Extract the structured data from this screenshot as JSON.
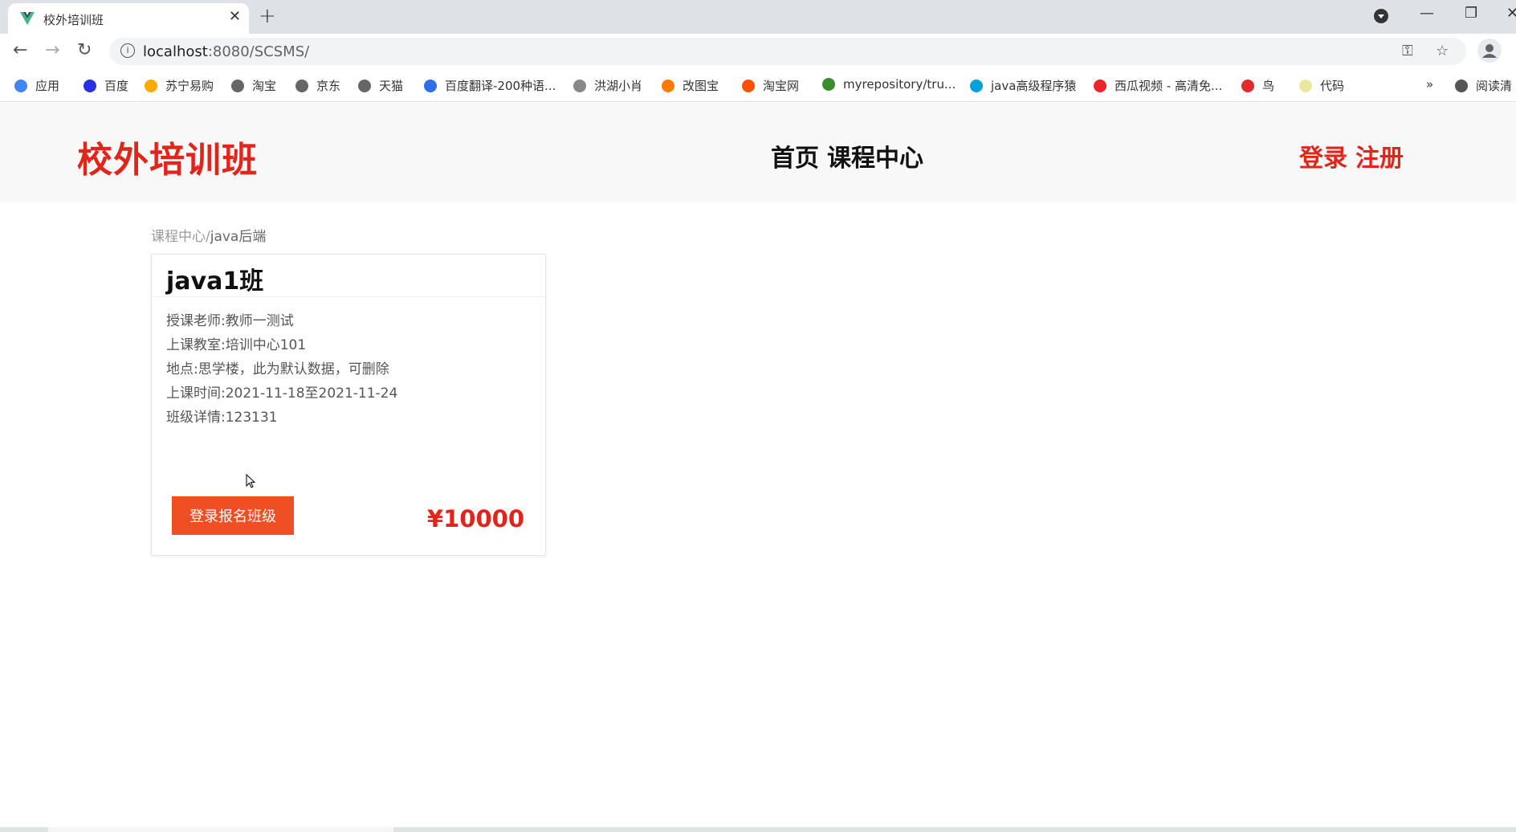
{
  "browser": {
    "tab_title": "校外培训班",
    "url_host": "localhost",
    "url_path": ":8080/SCSMS/",
    "bookmarks": [
      {
        "label": "应用",
        "color": "#4285f4"
      },
      {
        "label": "百度",
        "color": "#2932e1"
      },
      {
        "label": "苏宁易购",
        "color": "#ffaa00"
      },
      {
        "label": "淘宝",
        "color": "#666666"
      },
      {
        "label": "京东",
        "color": "#666666"
      },
      {
        "label": "天猫",
        "color": "#666666"
      },
      {
        "label": "百度翻译-200种语...",
        "color": "#2f6ee8"
      },
      {
        "label": "洪湖小肖",
        "color": "#888888"
      },
      {
        "label": "改图宝",
        "color": "#ff7a00"
      },
      {
        "label": "淘宝网",
        "color": "#ff5000"
      },
      {
        "label": "myrepository/tru...",
        "color": "#3c8d2f"
      },
      {
        "label": "java高级程序猿",
        "color": "#00a1d6"
      },
      {
        "label": "西瓜视频 - 高清免...",
        "color": "#f0222a"
      },
      {
        "label": "鸟",
        "color": "#e22b2b"
      },
      {
        "label": "代码",
        "color": "#e8e8a0"
      },
      {
        "label": "阅读清",
        "color": "#555555"
      }
    ],
    "more_bookmarks": "»"
  },
  "header": {
    "logo": "校外培训班",
    "nav": [
      "首页",
      "课程中心"
    ],
    "auth": [
      "登录",
      "注册"
    ]
  },
  "breadcrumb": {
    "parent": "课程中心",
    "separator": "/",
    "current": "java后端"
  },
  "card": {
    "title": "java1班",
    "teacher": "授课老师:教师一测试",
    "classroom": "上课教室:培训中心101",
    "location": "地点:思学楼，此为默认数据，可删除",
    "time": "上课时间:2021-11-18至2021-11-24",
    "details": "班级详情:123131",
    "enroll_label": "登录报名班级",
    "price": "¥10000"
  },
  "colors": {
    "brand_red": "#e1251b",
    "button_orange": "#f04e23"
  }
}
